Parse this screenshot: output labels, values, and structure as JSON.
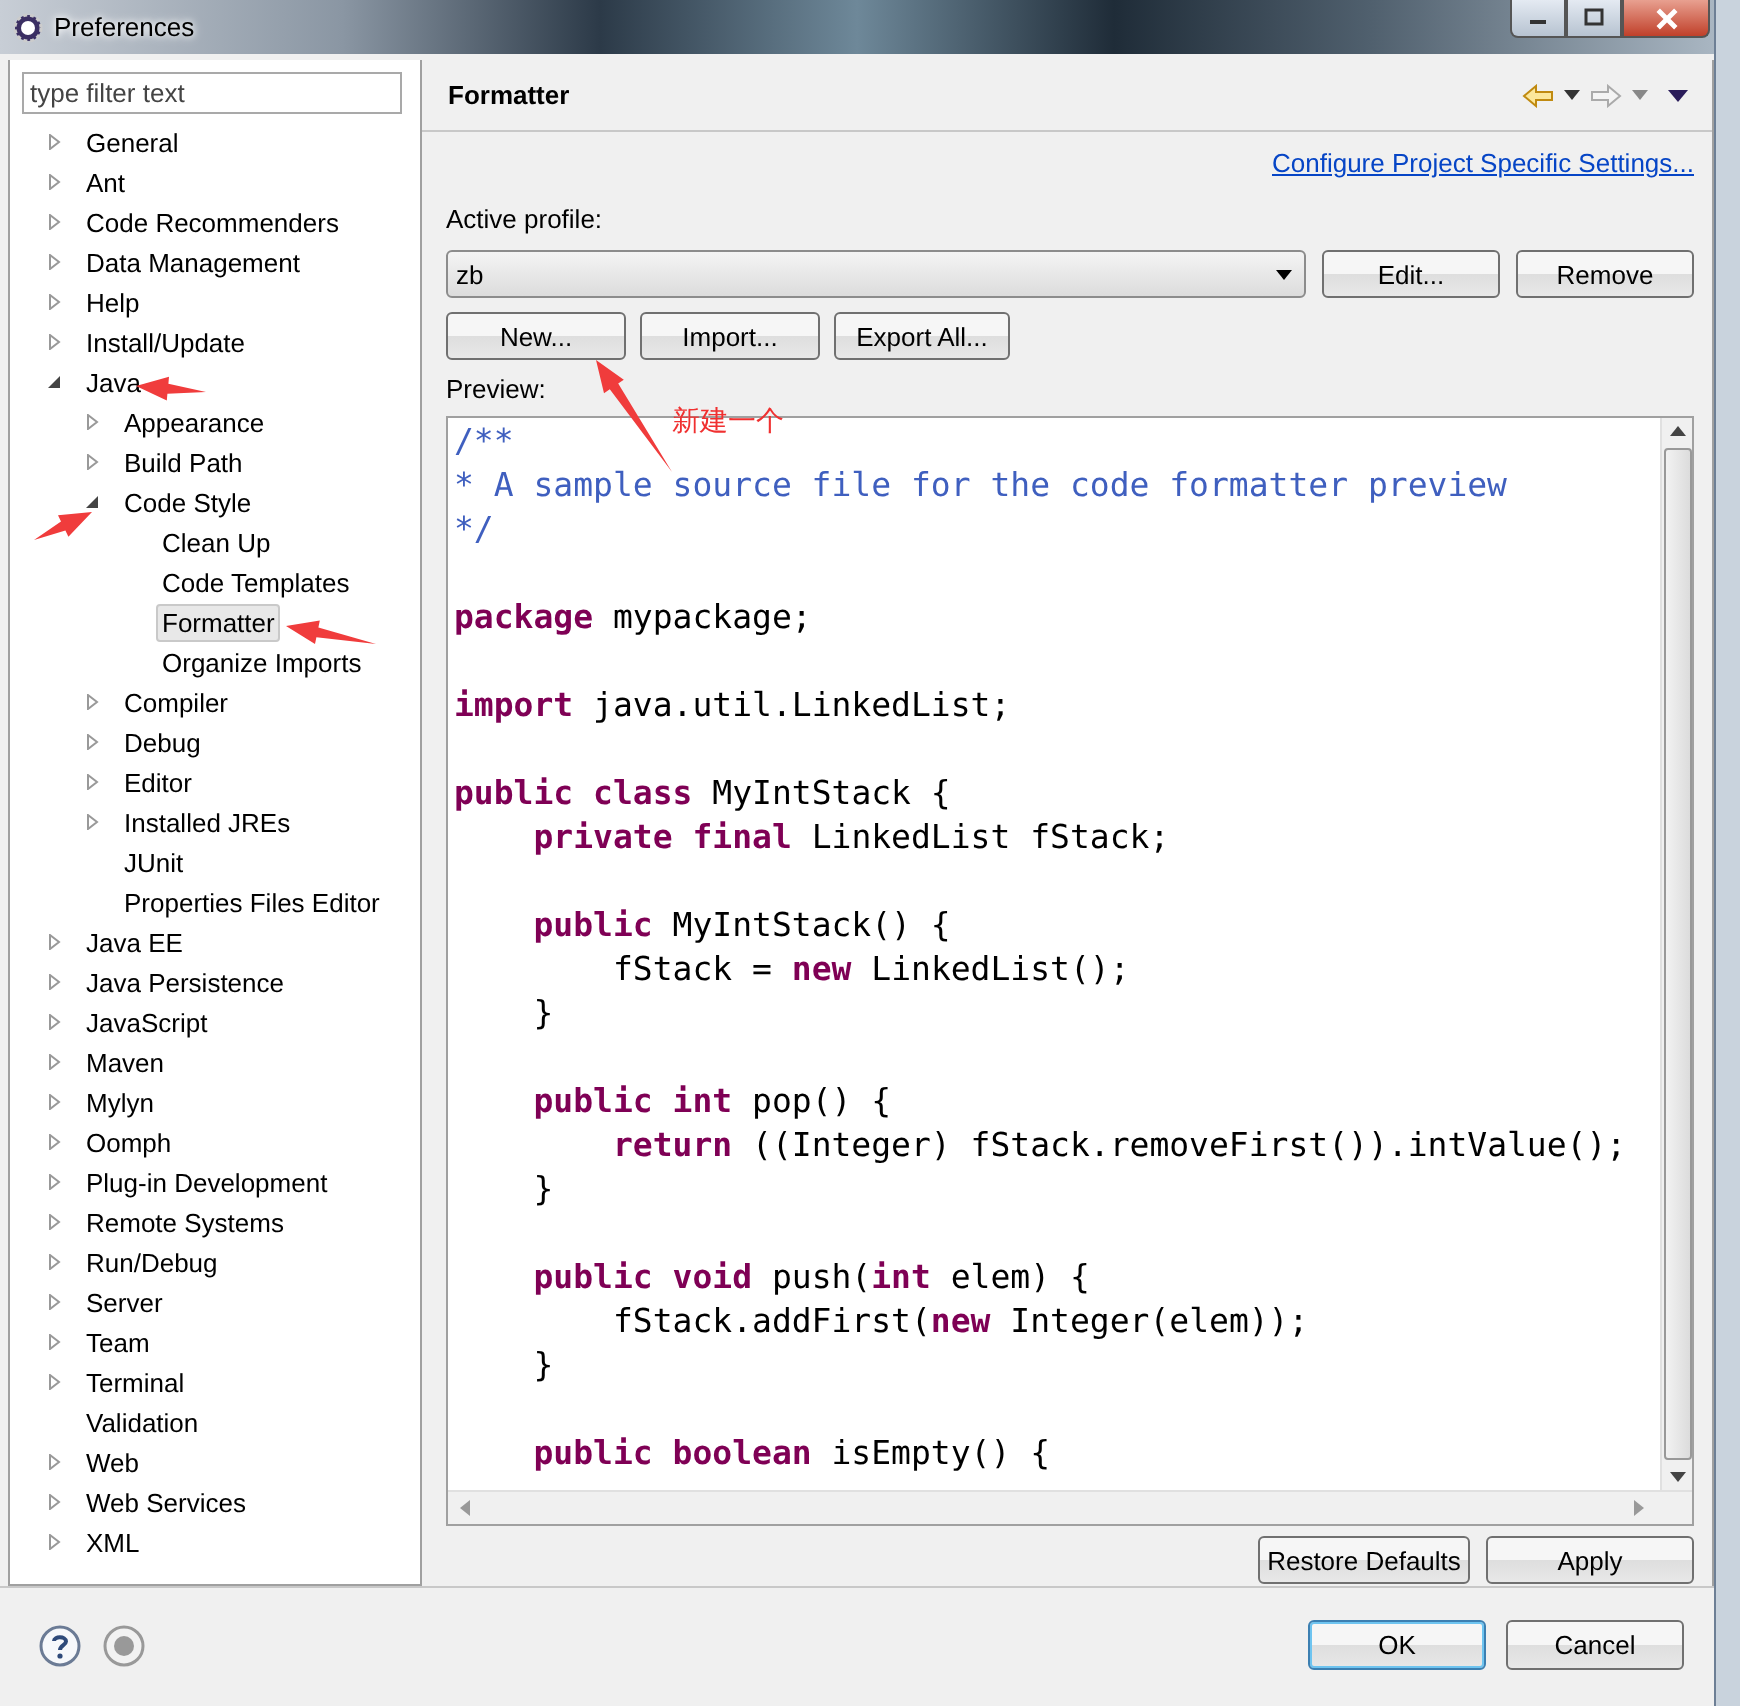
{
  "window": {
    "title": "Preferences"
  },
  "filter": {
    "placeholder": "type filter text"
  },
  "tree": [
    {
      "label": "General",
      "kind": "node",
      "expanded": false,
      "selected": false
    },
    {
      "label": "Ant",
      "kind": "node",
      "expanded": false,
      "selected": false
    },
    {
      "label": "Code Recommenders",
      "kind": "node",
      "expanded": false,
      "selected": false
    },
    {
      "label": "Data Management",
      "kind": "node",
      "expanded": false,
      "selected": false
    },
    {
      "label": "Help",
      "kind": "node",
      "expanded": false,
      "selected": false
    },
    {
      "label": "Install/Update",
      "kind": "node",
      "expanded": false,
      "selected": false
    },
    {
      "label": "Java",
      "kind": "node",
      "expanded": true,
      "selected": false,
      "children": [
        {
          "label": "Appearance",
          "kind": "node",
          "expanded": false,
          "selected": false
        },
        {
          "label": "Build Path",
          "kind": "node",
          "expanded": false,
          "selected": false
        },
        {
          "label": "Code Style",
          "kind": "node",
          "expanded": true,
          "selected": false,
          "children": [
            {
              "label": "Clean Up",
              "kind": "leaf",
              "selected": false
            },
            {
              "label": "Code Templates",
              "kind": "leaf",
              "selected": false
            },
            {
              "label": "Formatter",
              "kind": "leaf",
              "selected": true
            },
            {
              "label": "Organize Imports",
              "kind": "leaf",
              "selected": false
            }
          ]
        },
        {
          "label": "Compiler",
          "kind": "node",
          "expanded": false,
          "selected": false
        },
        {
          "label": "Debug",
          "kind": "node",
          "expanded": false,
          "selected": false
        },
        {
          "label": "Editor",
          "kind": "node",
          "expanded": false,
          "selected": false
        },
        {
          "label": "Installed JREs",
          "kind": "node",
          "expanded": false,
          "selected": false
        },
        {
          "label": "JUnit",
          "kind": "leaf",
          "selected": false
        },
        {
          "label": "Properties Files Editor",
          "kind": "leaf",
          "selected": false
        }
      ]
    },
    {
      "label": "Java EE",
      "kind": "node",
      "expanded": false,
      "selected": false
    },
    {
      "label": "Java Persistence",
      "kind": "node",
      "expanded": false,
      "selected": false
    },
    {
      "label": "JavaScript",
      "kind": "node",
      "expanded": false,
      "selected": false
    },
    {
      "label": "Maven",
      "kind": "node",
      "expanded": false,
      "selected": false
    },
    {
      "label": "Mylyn",
      "kind": "node",
      "expanded": false,
      "selected": false
    },
    {
      "label": "Oomph",
      "kind": "node",
      "expanded": false,
      "selected": false
    },
    {
      "label": "Plug-in Development",
      "kind": "node",
      "expanded": false,
      "selected": false
    },
    {
      "label": "Remote Systems",
      "kind": "node",
      "expanded": false,
      "selected": false
    },
    {
      "label": "Run/Debug",
      "kind": "node",
      "expanded": false,
      "selected": false
    },
    {
      "label": "Server",
      "kind": "node",
      "expanded": false,
      "selected": false
    },
    {
      "label": "Team",
      "kind": "node",
      "expanded": false,
      "selected": false
    },
    {
      "label": "Terminal",
      "kind": "node",
      "expanded": false,
      "selected": false
    },
    {
      "label": "Validation",
      "kind": "leaf",
      "selected": false
    },
    {
      "label": "Web",
      "kind": "node",
      "expanded": false,
      "selected": false
    },
    {
      "label": "Web Services",
      "kind": "node",
      "expanded": false,
      "selected": false
    },
    {
      "label": "XML",
      "kind": "node",
      "expanded": false,
      "selected": false
    }
  ],
  "page": {
    "title": "Formatter",
    "project_link": "Configure Project Specific Settings...",
    "profile_label": "Active profile:",
    "profile_value": "zb",
    "profile_buttons": [
      "Edit...",
      "Remove"
    ],
    "action_buttons": [
      "New...",
      "Import...",
      "Export All..."
    ],
    "preview_label": "Preview:",
    "code": [
      {
        "kind": "code",
        "tokens": [
          {
            "kind": "comment",
            "text": "/**"
          }
        ]
      },
      {
        "kind": "code",
        "tokens": [
          {
            "kind": "comment",
            "text": "* A sample source file for the code formatter preview"
          }
        ]
      },
      {
        "kind": "code",
        "tokens": [
          {
            "kind": "comment",
            "text": "*/"
          }
        ]
      },
      {
        "kind": "blank"
      },
      {
        "kind": "code",
        "tokens": [
          {
            "kind": "keyword",
            "text": "package"
          },
          {
            "kind": "plain",
            "text": " mypackage;"
          }
        ]
      },
      {
        "kind": "blank"
      },
      {
        "kind": "code",
        "tokens": [
          {
            "kind": "keyword",
            "text": "import"
          },
          {
            "kind": "plain",
            "text": " java.util.LinkedList;"
          }
        ]
      },
      {
        "kind": "blank"
      },
      {
        "kind": "code",
        "tokens": [
          {
            "kind": "keyword",
            "text": "public class"
          },
          {
            "kind": "plain",
            "text": " MyIntStack {"
          }
        ]
      },
      {
        "kind": "code",
        "tokens": [
          {
            "kind": "keyword",
            "text": "    private final"
          },
          {
            "kind": "plain",
            "text": " LinkedList fStack;"
          }
        ]
      },
      {
        "kind": "blank"
      },
      {
        "kind": "code",
        "tokens": [
          {
            "kind": "keyword",
            "text": "    public"
          },
          {
            "kind": "plain",
            "text": " MyIntStack() {"
          }
        ]
      },
      {
        "kind": "code",
        "tokens": [
          {
            "kind": "plain",
            "text": "        fStack = "
          },
          {
            "kind": "keyword",
            "text": "new"
          },
          {
            "kind": "plain",
            "text": " LinkedList();"
          }
        ]
      },
      {
        "kind": "code",
        "tokens": [
          {
            "kind": "plain",
            "text": "    }"
          }
        ]
      },
      {
        "kind": "blank"
      },
      {
        "kind": "code",
        "tokens": [
          {
            "kind": "keyword",
            "text": "    public int"
          },
          {
            "kind": "plain",
            "text": " pop() {"
          }
        ]
      },
      {
        "kind": "code",
        "tokens": [
          {
            "kind": "keyword",
            "text": "        return"
          },
          {
            "kind": "plain",
            "text": " ((Integer) fStack.removeFirst()).intValue();"
          }
        ]
      },
      {
        "kind": "code",
        "tokens": [
          {
            "kind": "plain",
            "text": "    }"
          }
        ]
      },
      {
        "kind": "blank"
      },
      {
        "kind": "code",
        "tokens": [
          {
            "kind": "keyword",
            "text": "    public void"
          },
          {
            "kind": "plain",
            "text": " push("
          },
          {
            "kind": "keyword",
            "text": "int"
          },
          {
            "kind": "plain",
            "text": " elem) {"
          }
        ]
      },
      {
        "kind": "code",
        "tokens": [
          {
            "kind": "plain",
            "text": "        fStack.addFirst("
          },
          {
            "kind": "keyword",
            "text": "new"
          },
          {
            "kind": "plain",
            "text": " Integer(elem));"
          }
        ]
      },
      {
        "kind": "code",
        "tokens": [
          {
            "kind": "plain",
            "text": "    }"
          }
        ]
      },
      {
        "kind": "blank"
      },
      {
        "kind": "code",
        "tokens": [
          {
            "kind": "keyword",
            "text": "    public boolean"
          },
          {
            "kind": "plain",
            "text": " isEmpty() {"
          }
        ]
      }
    ],
    "footer_buttons": [
      "Restore Defaults",
      "Apply"
    ]
  },
  "dialog_buttons": [
    {
      "label": "OK",
      "default": true
    },
    {
      "label": "Cancel",
      "default": false
    }
  ],
  "annotation": {
    "text": "新建一个"
  }
}
